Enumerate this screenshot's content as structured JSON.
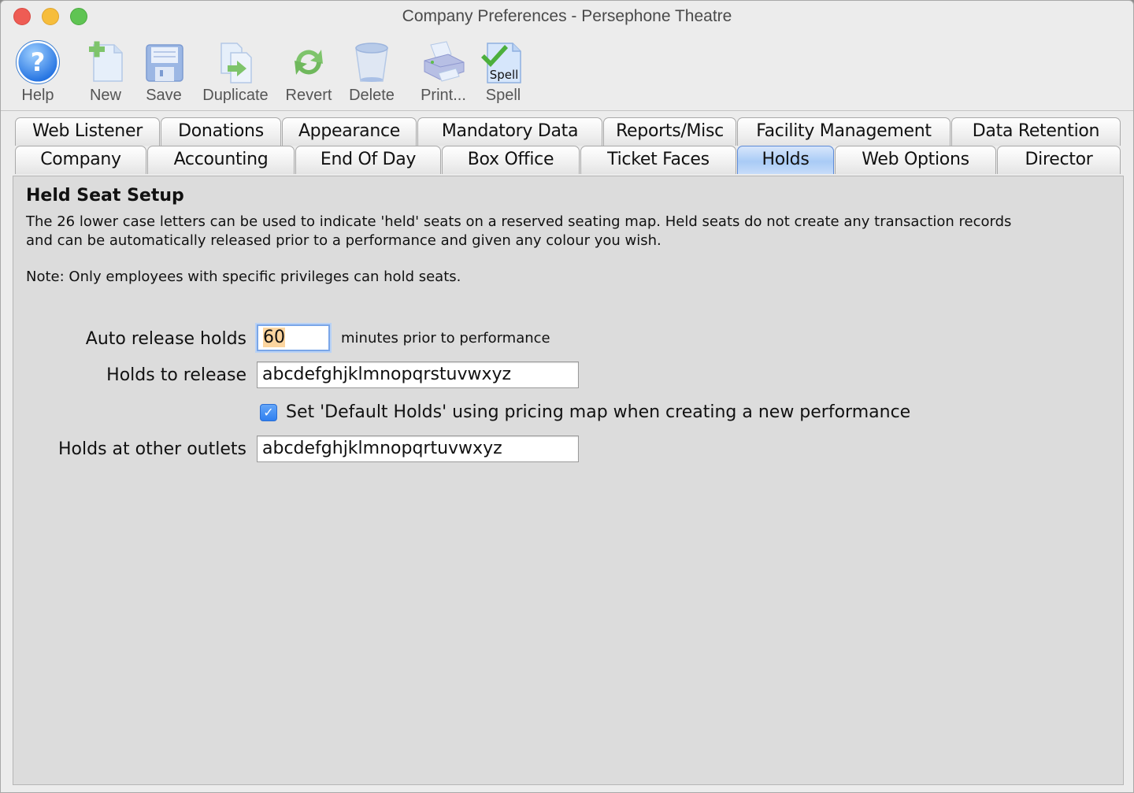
{
  "window": {
    "title": "Company Preferences - Persephone Theatre"
  },
  "toolbar": {
    "items": [
      {
        "label": "Help",
        "icon": "help-icon"
      },
      {
        "label": "New",
        "icon": "new-document-icon"
      },
      {
        "label": "Save",
        "icon": "save-floppy-icon"
      },
      {
        "label": "Duplicate",
        "icon": "duplicate-icon"
      },
      {
        "label": "Revert",
        "icon": "revert-icon"
      },
      {
        "label": "Delete",
        "icon": "delete-bin-icon"
      },
      {
        "label": "Print...",
        "icon": "printer-icon"
      },
      {
        "label": "Spell",
        "icon": "spell-check-icon",
        "icon_text": "Spell"
      }
    ]
  },
  "tabs": {
    "row1": [
      "Web Listener",
      "Donations",
      "Appearance",
      "Mandatory Data",
      "Reports/Misc",
      "Facility Management",
      "Data Retention"
    ],
    "row2": [
      "Company",
      "Accounting",
      "End Of Day",
      "Box Office",
      "Ticket Faces",
      "Holds",
      "Web Options",
      "Director"
    ],
    "selected": "Holds"
  },
  "panel": {
    "title": "Held Seat Setup",
    "description_line1": "The 26 lower case letters can be used to indicate 'held' seats on a reserved seating map.  Held seats do not create any transaction records",
    "description_line2": "and can be automatically released prior to a performance and given any colour you wish.",
    "note": "Note: Only employees with specific privileges can hold seats.",
    "auto_release": {
      "label": "Auto release holds",
      "value": "60",
      "suffix": "minutes prior to performance"
    },
    "holds_to_release": {
      "label": "Holds to release",
      "value": "abcdefghjklmnopqrstuvwxyz"
    },
    "default_holds_checkbox": {
      "label": "Set 'Default Holds' using pricing map when creating a new performance",
      "checked": true
    },
    "holds_other_outlets": {
      "label": "Holds at other outlets",
      "value": "abcdefghjklmnopqrtuvwxyz"
    }
  },
  "colors": {
    "selected_tab": "#a9cbf6",
    "focus_ring": "#7aa6e8",
    "checkbox": "#2f7ff0",
    "selection_highlight": "#fcd59f"
  }
}
